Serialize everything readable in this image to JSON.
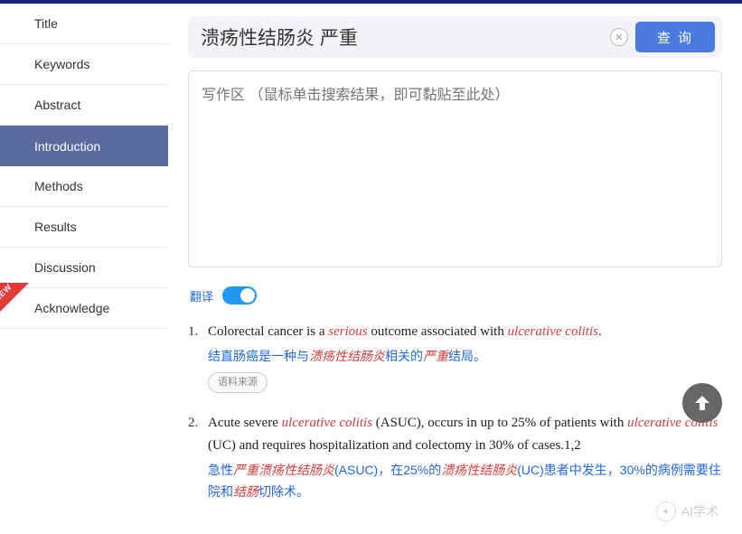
{
  "sidebar": {
    "items": [
      {
        "label": "Title"
      },
      {
        "label": "Keywords"
      },
      {
        "label": "Abstract"
      },
      {
        "label": "Introduction",
        "active": true
      },
      {
        "label": "Methods"
      },
      {
        "label": "Results"
      },
      {
        "label": "Discussion"
      },
      {
        "label": "Acknowledge",
        "new": true
      }
    ],
    "new_badge": "NEW"
  },
  "search": {
    "value": "溃疡性结肠炎 严重",
    "query_btn": "查 询"
  },
  "writearea": {
    "placeholder": "写作区 （鼠标单击搜索结果，即可黏贴至此处）"
  },
  "translate": {
    "label": "翻译",
    "on": true
  },
  "results": [
    {
      "num": "1.",
      "en_pre": "Colorectal cancer is a ",
      "en_hl1": "serious",
      "en_mid": " outcome associated with ",
      "en_hl2": "ulcerative colitis",
      "en_post": ".",
      "cn_pre": "结直肠癌是一种与",
      "cn_hl1": "溃疡性结肠炎",
      "cn_mid": "相关的",
      "cn_hl2": "严重",
      "cn_post": "结局。",
      "source": "语料来源"
    },
    {
      "num": "2.",
      "en_pre": "Acute severe ",
      "en_hl1": "ulcerative colitis",
      "en_mid": " (ASUC), occurs in up to 25% of patients with ",
      "en_hl2": "ulcerative colitis",
      "en_post": " (UC) and requires hospitalization and colectomy in 30% of cases.1,2",
      "cn_pre": "急性",
      "cn_hl1": "严重溃疡性结肠炎",
      "cn_mid": "(ASUC)，在25%的",
      "cn_hl2": "溃疡性结肠炎",
      "cn_mid2": "(UC)患者中发生，30%的病例需要住院和",
      "cn_hl3": "结肠",
      "cn_post": "切除术。"
    }
  ],
  "watermark": "AI学术"
}
